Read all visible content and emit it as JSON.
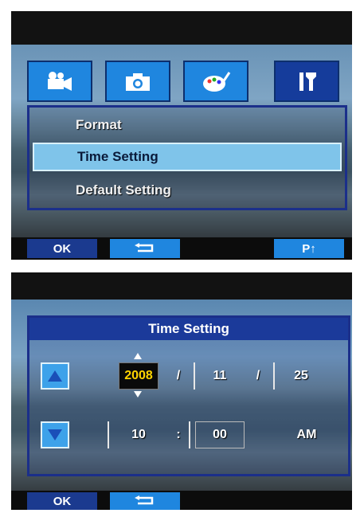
{
  "screen1": {
    "tabs": [
      {
        "icon": "video-camera-icon"
      },
      {
        "icon": "camera-icon"
      },
      {
        "icon": "palette-icon"
      },
      {
        "icon": "tools-icon",
        "active": true
      }
    ],
    "menu": [
      {
        "label": "Format"
      },
      {
        "label": "Time Setting",
        "selected": true
      },
      {
        "label": "Default Setting"
      }
    ],
    "bottom": {
      "ok": "OK",
      "back_icon": "return-arrow-icon",
      "page": "P↑"
    }
  },
  "screen2": {
    "dialog_title": "Time Setting",
    "date": {
      "year": "2008",
      "month": "11",
      "day": "25",
      "separator": "/"
    },
    "time": {
      "hour": "10",
      "minute": "00",
      "period": "AM",
      "separator": ":"
    },
    "bottom": {
      "ok": "OK",
      "back_icon": "return-arrow-icon"
    },
    "colors": {
      "accent_dark": "#1b3a9a",
      "accent_light": "#1f86df",
      "selection": "#7fc4ea",
      "selected_value": "#ffd400"
    }
  }
}
